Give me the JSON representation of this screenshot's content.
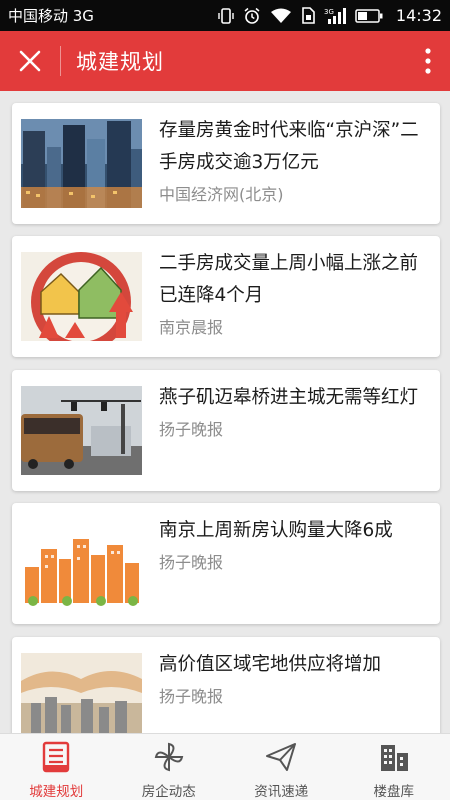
{
  "status_bar": {
    "carrier": "中国移动 3G",
    "time": "14:32",
    "icons": [
      "vibrate-icon",
      "alarm-icon",
      "wifi-icon",
      "sim-icon",
      "signal-3g-icon",
      "battery-icon"
    ]
  },
  "app_bar": {
    "title": "城建规划",
    "close_icon": "close-icon",
    "more_icon": "more-vertical-icon"
  },
  "articles": [
    {
      "title": "存量房黄金时代来临“京沪深”二手房成交逾3万亿元",
      "source": "中国经济网(北京)",
      "thumbnail": "city-skyscrapers"
    },
    {
      "title": "二手房成交量上周小幅上涨之前已连降4个月",
      "source": "南京晨报",
      "thumbnail": "house-arrows-illustration"
    },
    {
      "title": "燕子矶迈皋桥进主城无需等红灯",
      "source": "扬子晚报",
      "thumbnail": "traffic-road"
    },
    {
      "title": "南京上周新房认购量大降6成",
      "source": "扬子晚报",
      "thumbnail": "orange-buildings-illustration"
    },
    {
      "title": "高价值区域宅地供应将增加",
      "source": "扬子晚报",
      "thumbnail": "hands-buildings"
    }
  ],
  "bottom_nav": {
    "items": [
      {
        "label": "城建规划",
        "icon": "document-list-icon",
        "active": true
      },
      {
        "label": "房企动态",
        "icon": "pinwheel-icon",
        "active": false
      },
      {
        "label": "资讯速递",
        "icon": "paper-plane-icon",
        "active": false
      },
      {
        "label": "楼盘库",
        "icon": "buildings-icon",
        "active": false
      }
    ]
  },
  "colors": {
    "primary": "#e23b3b",
    "background": "#e9e9e9",
    "source_text": "#8d8d8d"
  }
}
